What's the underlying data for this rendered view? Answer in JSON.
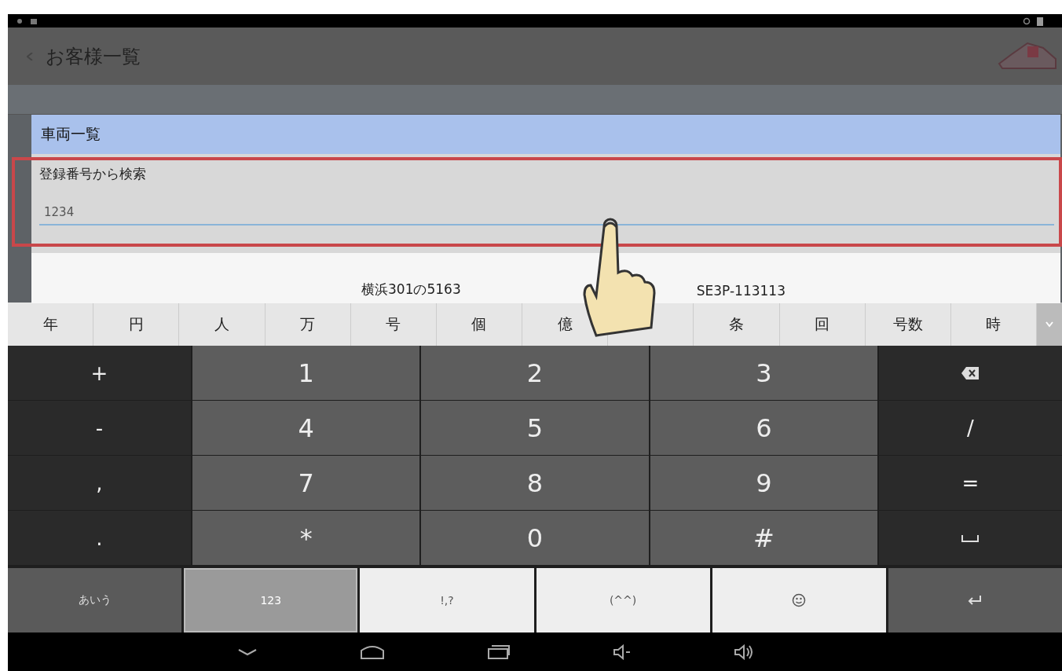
{
  "action_bar": {
    "title": "お客様一覧"
  },
  "dialog": {
    "title": "車両一覧",
    "search_label": "登録番号から検索",
    "search_value": "1234",
    "rows": [
      {
        "plate": "横浜301の5163",
        "model": "SE3P-113113"
      }
    ]
  },
  "candidates": [
    "年",
    "円",
    "人",
    "万",
    "号",
    "個",
    "億",
    "条",
    "回",
    "号数",
    "時"
  ],
  "keypad": {
    "rows": [
      {
        "left": {
          "label": "+",
          "kind": "text"
        },
        "keys": [
          "1",
          "2",
          "3"
        ],
        "right": {
          "kind": "backspace"
        }
      },
      {
        "left": {
          "label": "-",
          "kind": "text"
        },
        "keys": [
          "4",
          "5",
          "6"
        ],
        "right": {
          "label": "/",
          "kind": "text"
        }
      },
      {
        "left": {
          "label": ",",
          "kind": "text"
        },
        "keys": [
          "7",
          "8",
          "9"
        ],
        "right": {
          "label": "=",
          "kind": "text"
        }
      },
      {
        "left": {
          "label": ".",
          "kind": "text"
        },
        "keys": [
          "*",
          "0",
          "#"
        ],
        "right": {
          "kind": "space"
        }
      }
    ]
  },
  "mode_keys": [
    {
      "label": "あいう",
      "kind": "text",
      "selected": false
    },
    {
      "label": "123",
      "kind": "text",
      "selected": true
    },
    {
      "label": "!,?",
      "kind": "text",
      "selected": false
    },
    {
      "label": "(^^)",
      "kind": "text",
      "selected": false
    },
    {
      "kind": "emoji",
      "selected": false
    },
    {
      "kind": "enter",
      "selected": false
    }
  ]
}
